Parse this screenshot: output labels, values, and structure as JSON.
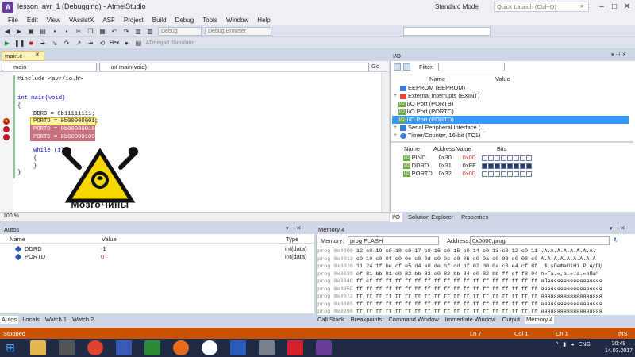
{
  "window": {
    "title": "lesson_avr_1 (Debugging) - AtmelStudio",
    "mode": "Standard Mode",
    "quick_launch_placeholder": "Quick Launch (Ctrl+Q)"
  },
  "menu": [
    "File",
    "Edit",
    "View",
    "VAssistX",
    "ASF",
    "Project",
    "Build",
    "Debug",
    "Tools",
    "Window",
    "Help"
  ],
  "toolbar": {
    "config_combo": "Debug",
    "debug_browser": "Debug Browser",
    "hex_label": "Hex",
    "device": "ATmega8",
    "tool": "Simulator"
  },
  "editor": {
    "tab_label": "main.c",
    "nav_scope": "main",
    "nav_function": "int main(void)",
    "nav_go": "Go",
    "zoom": "100 %",
    "lines": {
      "l1": "#include <avr/io.h>",
      "l2": "int main(void)",
      "l3": "{",
      "l4": "DDRD = 0b11111111;",
      "l5": "PORTD = 0b00000001;",
      "l6": "PORTD = 0b00000010;",
      "l7": "PORTD = 0b00000100;",
      "l8": "while (1)",
      "l9": "{",
      "l10": "}",
      "l11": "}"
    },
    "logo_text": "МозгоЧины"
  },
  "io": {
    "title": "I/O",
    "filter_label": "Filter:",
    "col_name": "Name",
    "col_value": "Value",
    "tree": [
      {
        "name": "EEPROM (EEPROM)",
        "expand": ""
      },
      {
        "name": "External Interrupts (EXINT)",
        "expand": "+"
      },
      {
        "name": "I/O Port (PORTB)",
        "expand": ""
      },
      {
        "name": "I/O Port (PORTC)",
        "expand": ""
      },
      {
        "name": "I/O Port (PORTD)",
        "expand": ""
      },
      {
        "name": "Serial Peripheral Interface (...",
        "expand": "+"
      },
      {
        "name": "Timer/Counter, 16-bit (TC1)",
        "expand": "+"
      }
    ],
    "reg_headers": {
      "name": "Name",
      "address": "Address",
      "value": "Value",
      "bits": "Bits"
    },
    "registers": [
      {
        "name": "PIND",
        "address": "0x30",
        "value": "0x00",
        "bits": [
          0,
          0,
          0,
          0,
          0,
          0,
          0,
          0
        ]
      },
      {
        "name": "DDRD",
        "address": "0x31",
        "value": "0xFF",
        "bits": [
          1,
          1,
          1,
          1,
          1,
          1,
          1,
          1
        ]
      },
      {
        "name": "PORTD",
        "address": "0x32",
        "value": "0x00",
        "bits": [
          0,
          0,
          0,
          0,
          0,
          0,
          0,
          0
        ]
      }
    ],
    "tabs": [
      "I/O",
      "Solution Explorer",
      "Properties"
    ]
  },
  "autos": {
    "title": "Autos",
    "cols": {
      "name": "Name",
      "value": "Value",
      "type": "Type"
    },
    "rows": [
      {
        "name": "DDRD",
        "value": "-1",
        "type": "int{data}"
      },
      {
        "name": "PORTD",
        "value": "0",
        "type": "int{data}"
      }
    ],
    "tabs": [
      "Autos",
      "Locals",
      "Watch 1",
      "Watch 2"
    ]
  },
  "memory": {
    "title": "Memory 4",
    "memory_label": "Memory:",
    "memory_value": "prog FLASH",
    "address_label": "Address:",
    "address_value": "0x0000,prog",
    "lines": [
      {
        "addr": "prog 0x0000",
        "hex": "12 c0 19 c0 18 c0 17 c0 16 c0 15 c0 14 c0 13 c0 12 c0 11",
        "ascii": ".А.А.А.А.А.А.А.А."
      },
      {
        "addr": "prog 0x0013",
        "hex": "c0 10 c0 0f c0 0e c0 0d c0 0c c0 0b c0 0a c0 09 c0 08 c0",
        "ascii": "А.А.А.А.А.А.А.А.А"
      },
      {
        "addr": "prog 0x0026",
        "hex": "11 24 1f be cf e5 d4 e0 de bf cd bf 02 d0 0a c0 e4 cf 8f",
        "ascii": ".$.sПeФаЮїНі.Р.АдПЏ"
      },
      {
        "addr": "prog 0x0039",
        "hex": "ef 81 bb 81 e0 82 bb 82 e0 82 bb 84 e0 82 bb ff cf f8 94",
        "ascii": "п»Ґа.»,а.».а.»яПш\""
      },
      {
        "addr": "prog 0x004C",
        "hex": "ff cf ff ff ff ff ff ff ff ff ff ff ff ff ff ff ff ff ff",
        "ascii": "яПяяяяяяяяяяяяяяяяя"
      },
      {
        "addr": "prog 0x005F",
        "hex": "ff ff ff ff ff ff ff ff ff ff ff ff ff ff ff ff ff ff ff",
        "ascii": "яяяяяяяяяяяяяяяяяяя"
      },
      {
        "addr": "prog 0x0072",
        "hex": "ff ff ff ff ff ff ff ff ff ff ff ff ff ff ff ff ff ff ff",
        "ascii": "яяяяяяяяяяяяяяяяяяя"
      },
      {
        "addr": "prog 0x0085",
        "hex": "ff ff ff ff ff ff ff ff ff ff ff ff ff ff ff ff ff ff ff",
        "ascii": "яяяяяяяяяяяяяяяяяяя"
      },
      {
        "addr": "prog 0x0098",
        "hex": "ff ff ff ff ff ff ff ff ff ff ff ff ff ff ff ff ff ff ff",
        "ascii": "яяяяяяяяяяяяяяяяяяя"
      }
    ],
    "tabs": [
      "Call Stack",
      "Breakpoints",
      "Command Window",
      "Immediate Window",
      "Output",
      "Memory 4"
    ]
  },
  "status": {
    "state": "Stopped",
    "line": "Ln 7",
    "col": "Col 1",
    "ch": "Ch 1",
    "ins": "INS"
  },
  "taskbar": {
    "lang": "ENG",
    "time": "20:49",
    "date": "14.03.2017"
  },
  "colors": {
    "status_bar": "#ca5100",
    "selection": "#3399ff",
    "breakpoint": "#c5152c",
    "hex_value_changed": "#e0301e"
  }
}
